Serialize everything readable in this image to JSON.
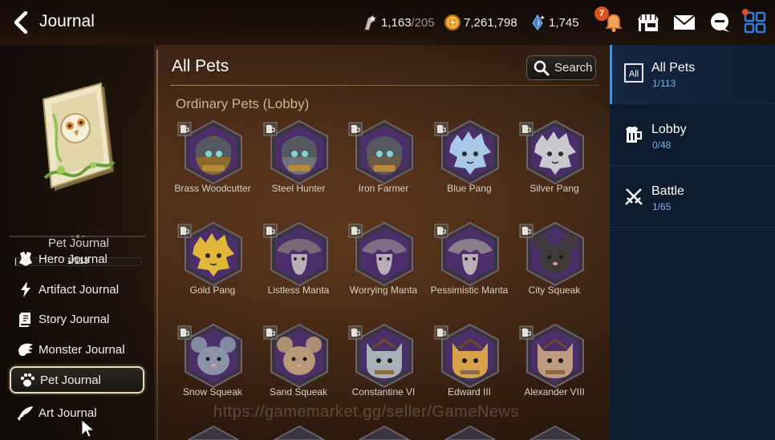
{
  "header": {
    "title": "Journal",
    "stamina_value": "1,163",
    "stamina_max": "/205",
    "gold": "7,261,798",
    "skystones": "1,745",
    "notification_count": "7"
  },
  "sidebar": {
    "book_label": "Pet Journal",
    "progress_text": "1/113",
    "progress_fraction": 0.009,
    "items": [
      {
        "label": "Hero Journal",
        "icon": "hero-icon"
      },
      {
        "label": "Artifact Journal",
        "icon": "artifact-icon"
      },
      {
        "label": "Story Journal",
        "icon": "story-icon"
      },
      {
        "label": "Monster Journal",
        "icon": "monster-icon"
      },
      {
        "label": "Pet Journal",
        "icon": "paw-icon",
        "active": true
      },
      {
        "label": "Art Journal",
        "icon": "art-icon"
      }
    ]
  },
  "main": {
    "title": "All Pets",
    "search_label": "Search",
    "section_title": "Ordinary Pets (Lobby)",
    "pets": [
      {
        "name": "Brass Woodcutter",
        "kind": "robot",
        "color": "#8a6a2c"
      },
      {
        "name": "Steel Hunter",
        "kind": "robot",
        "color": "#6f7378"
      },
      {
        "name": "Iron Farmer",
        "kind": "robot",
        "color": "#6a5a48"
      },
      {
        "name": "Blue Pang",
        "kind": "pang",
        "color": "#a9c8e8"
      },
      {
        "name": "Silver Pang",
        "kind": "pang",
        "color": "#c9c9cf"
      },
      {
        "name": "Gold Pang",
        "kind": "pang",
        "color": "#e2b838"
      },
      {
        "name": "Listless Manta",
        "kind": "manta",
        "color": "#7a6a78"
      },
      {
        "name": "Worrying Manta",
        "kind": "manta",
        "color": "#7e6e86"
      },
      {
        "name": "Pessimistic Manta",
        "kind": "manta",
        "color": "#8a7f8a"
      },
      {
        "name": "City Squeak",
        "kind": "squeak",
        "color": "#3e3a3a"
      },
      {
        "name": "Snow Squeak",
        "kind": "squeak",
        "color": "#8a93a8"
      },
      {
        "name": "Sand Squeak",
        "kind": "squeak",
        "color": "#b89a76"
      },
      {
        "name": "Constantine VI",
        "kind": "cat",
        "color": "#a8b0b8"
      },
      {
        "name": "Edward III",
        "kind": "cat",
        "color": "#d7a24a"
      },
      {
        "name": "Alexander VIII",
        "kind": "cat",
        "color": "#c09a80"
      }
    ]
  },
  "categories": [
    {
      "label": "All Pets",
      "count": "1/113",
      "icon": "all-icon",
      "active": true
    },
    {
      "label": "Lobby",
      "count": "0/48",
      "icon": "beer-mug-icon"
    },
    {
      "label": "Battle",
      "count": "1/65",
      "icon": "crossed-swords-icon"
    }
  ],
  "watermark": "https://gamemarket.gg/seller/GameNews",
  "colors": {
    "right_panel": "#0d1b2e",
    "accent_blue": "#4f8cd6",
    "hex_frame": "#3a3340",
    "hex_inner": "#4b2f6a"
  }
}
